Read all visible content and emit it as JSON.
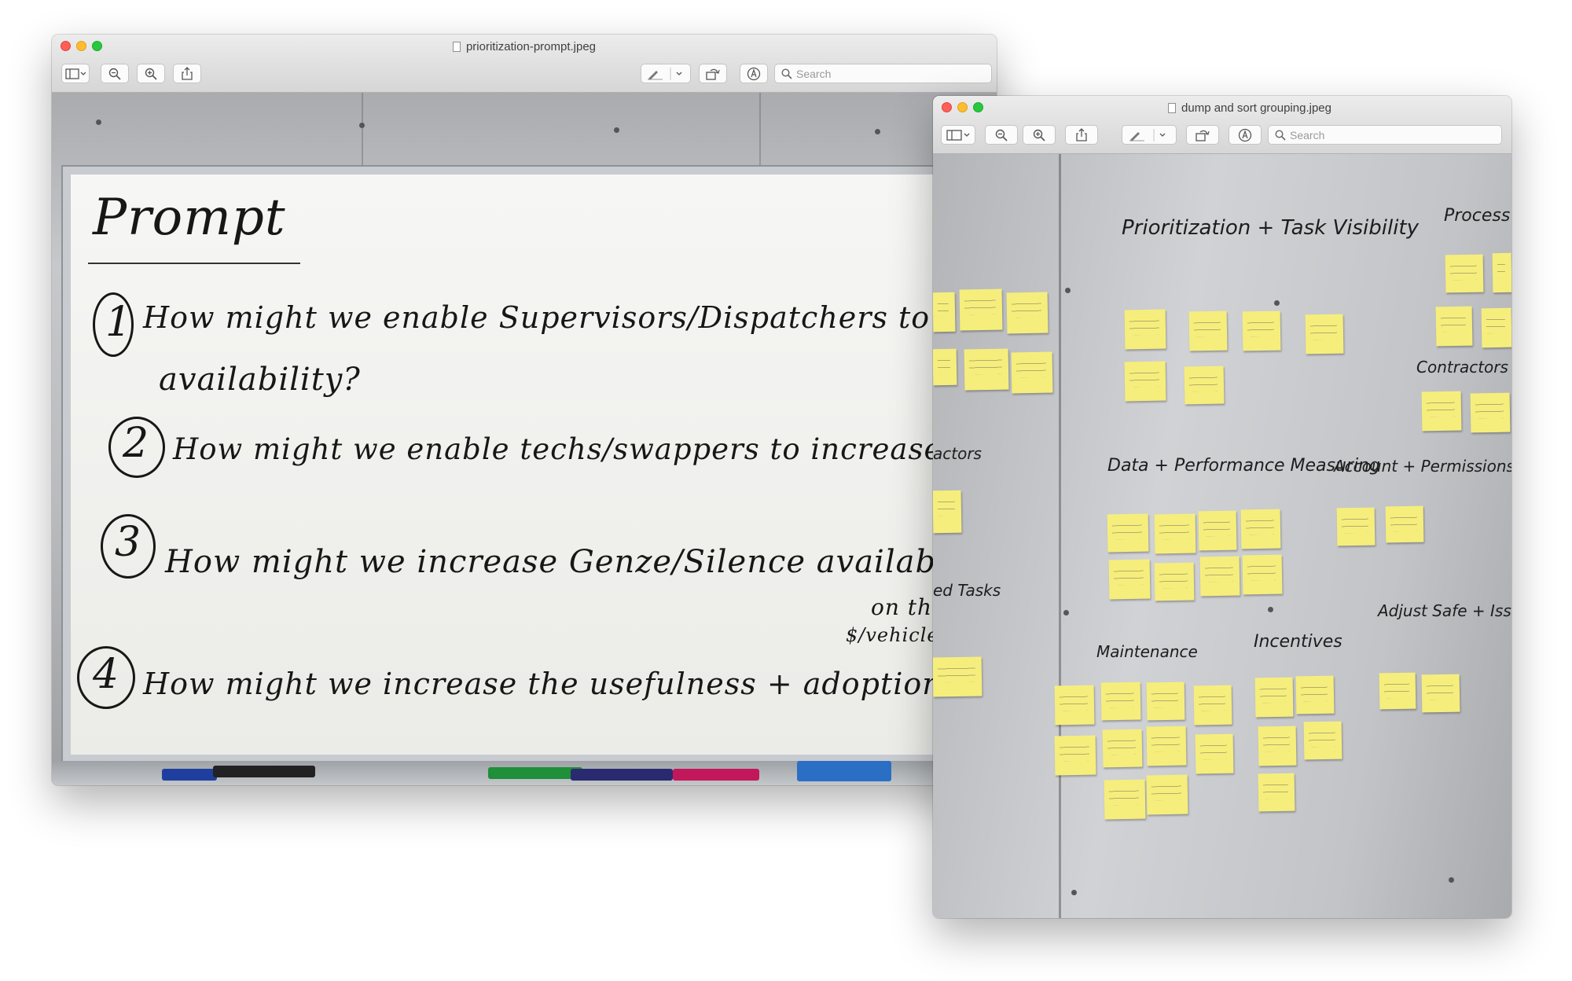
{
  "windows": [
    {
      "title": "prioritization-prompt.jpeg",
      "search_placeholder": "Search",
      "photo": {
        "heading": "Prompt",
        "prompts": [
          {
            "number": "1",
            "lines": [
              "How might we enable Supervisors/Dispatchers to increase",
              "availability?"
            ]
          },
          {
            "number": "2",
            "lines": [
              "How might we enable techs/swappers to increase availability?"
            ]
          },
          {
            "number": "3",
            "lines": [
              "How might we increase Genze/Silence availability (revenue",
              "on the",
              "$/vehicles)"
            ]
          },
          {
            "number": "4",
            "lines": [
              "How might we increase the usefulness + adoption of Fleet App"
            ]
          }
        ]
      }
    },
    {
      "title": "dump and sort grouping.jpeg",
      "search_placeholder": "Search",
      "photo": {
        "groups": [
          {
            "label": "Prioritization + Task Visibility"
          },
          {
            "label": "Process + Feedback"
          },
          {
            "label": "Contractors + Charging"
          },
          {
            "label": "actors"
          },
          {
            "label": "Data + Performance Measuring"
          },
          {
            "label": "Account + Permissions"
          },
          {
            "label": "ed Tasks"
          },
          {
            "label": "Adjust Safe + Issue generation"
          },
          {
            "label": "Maintenance"
          },
          {
            "label": "Incentives"
          }
        ]
      }
    }
  ]
}
